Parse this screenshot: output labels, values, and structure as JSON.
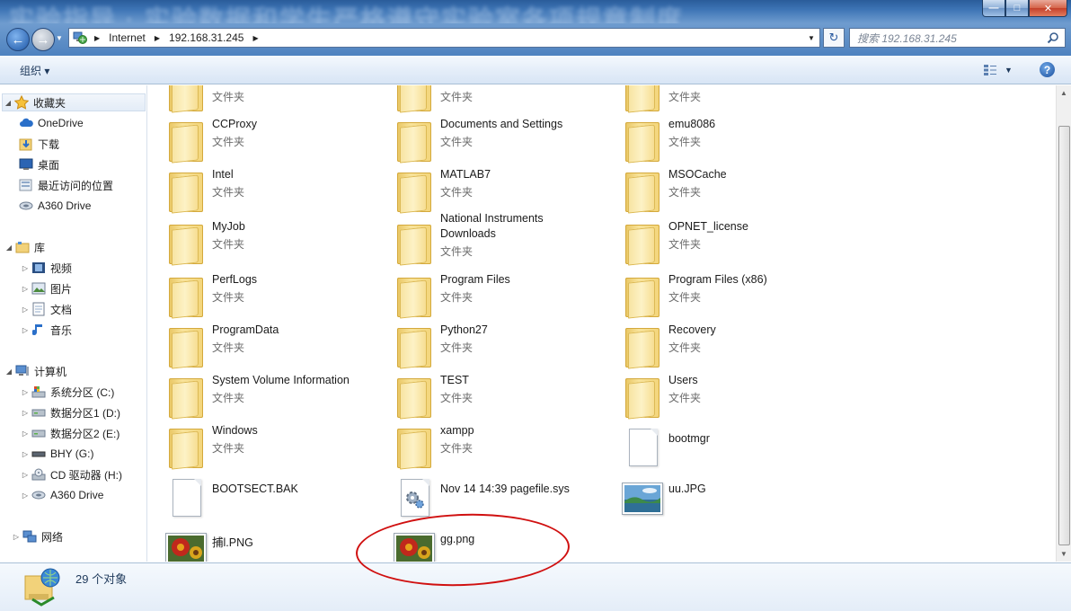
{
  "window": {
    "blurred_title": "实验指导 · 实验数据和学生严格遵守实验室各项规章制度",
    "minimize": "—",
    "maximize": "□",
    "close": "✕"
  },
  "address": {
    "crumbs": [
      "Internet",
      "192.168.31.245"
    ],
    "search_placeholder": "搜索 192.168.31.245"
  },
  "toolbar": {
    "organize_label": "组织 ▾",
    "help_label": "?"
  },
  "nav": {
    "favorites": "收藏夹",
    "favorites_items": [
      "OneDrive",
      "下载",
      "桌面",
      "最近访问的位置",
      "A360 Drive"
    ],
    "libraries": "库",
    "library_items": [
      "视频",
      "图片",
      "文档",
      "音乐"
    ],
    "computer": "计算机",
    "computer_items": [
      "系统分区 (C:)",
      "数据分区1 (D:)",
      "数据分区2 (E:)",
      "BHY (G:)",
      "CD 驱动器 (H:)",
      "A360 Drive"
    ],
    "network": "网络"
  },
  "files": {
    "type_folder": "文件夹",
    "top_partial": [
      "",
      "",
      ""
    ],
    "rows": [
      [
        "CCProxy",
        "Documents and Settings",
        "emu8086"
      ],
      [
        "Intel",
        "MATLAB7",
        "MSOCache"
      ],
      [
        "MyJob",
        "National Instruments Downloads",
        "OPNET_license"
      ],
      [
        "PerfLogs",
        "Program Files",
        "Program Files (x86)"
      ],
      [
        "ProgramData",
        "Python27",
        "Recovery"
      ],
      [
        "System Volume Information",
        "TEST",
        "Users"
      ],
      [
        "Windows",
        "xampp",
        "bootmgr"
      ],
      [
        "BOOTSECT.BAK",
        "Nov 14 14:39 pagefile.sys",
        "uu.JPG"
      ],
      [
        "捕l.PNG",
        "gg.png",
        ""
      ]
    ],
    "nat_line1": "National Instruments",
    "nat_line2": "Downloads"
  },
  "status": {
    "count": "29 个对象"
  },
  "colors": {
    "folder": "#f3d57a",
    "annotation_ring": "#d01010",
    "link_blue": "#1e395b"
  }
}
